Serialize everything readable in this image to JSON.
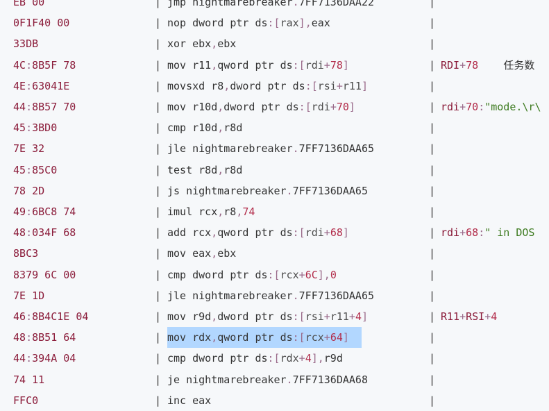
{
  "colors": {
    "background": "#f6f8fa",
    "bytes": "#8b1c3a",
    "text": "#333333",
    "operator": "#9a6a8a",
    "register": "#4c4c4c",
    "number": "#b22c4a",
    "string": "#3c7a1e",
    "selection": "#b2d7ff"
  },
  "rows": [
    {
      "bytes": "EB 00",
      "instruction": "jmp nightmarebreaker.7FF7136DAA22",
      "comment": ""
    },
    {
      "bytes": "0F1F40 00",
      "instruction": "nop dword ptr ds:[rax],eax",
      "comment": ""
    },
    {
      "bytes": "33DB",
      "instruction": "xor ebx,ebx",
      "comment": ""
    },
    {
      "bytes": "4C:8B5F 78",
      "instruction": "mov r11,qword ptr ds:[rdi+78]",
      "comment": "RDI+78    任务数"
    },
    {
      "bytes": "4E:63041E",
      "instruction": "movsxd r8,dword ptr ds:[rsi+r11]",
      "comment": ""
    },
    {
      "bytes": "44:8B57 70",
      "instruction": "mov r10d,dword ptr ds:[rdi+70]",
      "comment": "rdi+70:\"mode.\\r\\"
    },
    {
      "bytes": "45:3BD0",
      "instruction": "cmp r10d,r8d",
      "comment": ""
    },
    {
      "bytes": "7E 32",
      "instruction": "jle nightmarebreaker.7FF7136DAA65",
      "comment": ""
    },
    {
      "bytes": "45:85C0",
      "instruction": "test r8d,r8d",
      "comment": ""
    },
    {
      "bytes": "78 2D",
      "instruction": "js nightmarebreaker.7FF7136DAA65",
      "comment": ""
    },
    {
      "bytes": "49:6BC8 74",
      "instruction": "imul rcx,r8,74",
      "comment": ""
    },
    {
      "bytes": "48:034F 68",
      "instruction": "add rcx,qword ptr ds:[rdi+68]",
      "comment": "rdi+68:\" in DOS"
    },
    {
      "bytes": "8BC3",
      "instruction": "mov eax,ebx",
      "comment": ""
    },
    {
      "bytes": "8379 6C 00",
      "instruction": "cmp dword ptr ds:[rcx+6C],0",
      "comment": ""
    },
    {
      "bytes": "7E 1D",
      "instruction": "jle nightmarebreaker.7FF7136DAA65",
      "comment": ""
    },
    {
      "bytes": "46:8B4C1E 04",
      "instruction": "mov r9d,dword ptr ds:[rsi+r11+4]",
      "comment": "R11+RSI+4"
    },
    {
      "bytes": "48:8B51 64",
      "instruction": "mov rdx,qword ptr ds:[rcx+64]",
      "comment": "",
      "selected": true
    },
    {
      "bytes": "44:394A 04",
      "instruction": "cmp dword ptr ds:[rdx+4],r9d",
      "comment": ""
    },
    {
      "bytes": "74 11",
      "instruction": "je nightmarebreaker.7FF7136DAA68",
      "comment": ""
    },
    {
      "bytes": "FFC0",
      "instruction": "inc eax",
      "comment": ""
    }
  ]
}
